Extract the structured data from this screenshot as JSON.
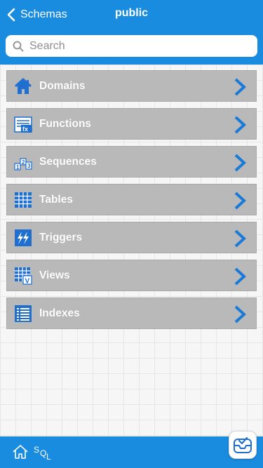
{
  "nav": {
    "back_label": "Schemas",
    "title": "public"
  },
  "search": {
    "placeholder": "Search"
  },
  "menu": [
    {
      "label": "Domains",
      "icon": "home-icon"
    },
    {
      "label": "Functions",
      "icon": "function-icon"
    },
    {
      "label": "Sequences",
      "icon": "sequence-icon"
    },
    {
      "label": "Tables",
      "icon": "table-icon"
    },
    {
      "label": "Triggers",
      "icon": "trigger-icon"
    },
    {
      "label": "Views",
      "icon": "view-icon"
    },
    {
      "label": "Indexes",
      "icon": "index-icon"
    }
  ],
  "toolbar": {
    "sql_s": "S",
    "sql_q": "Q",
    "sql_l": "L"
  },
  "colors": {
    "accent": "#1a8ce0",
    "item_bg": "#b9b9b9",
    "icon_blue": "#1f6fd0"
  }
}
